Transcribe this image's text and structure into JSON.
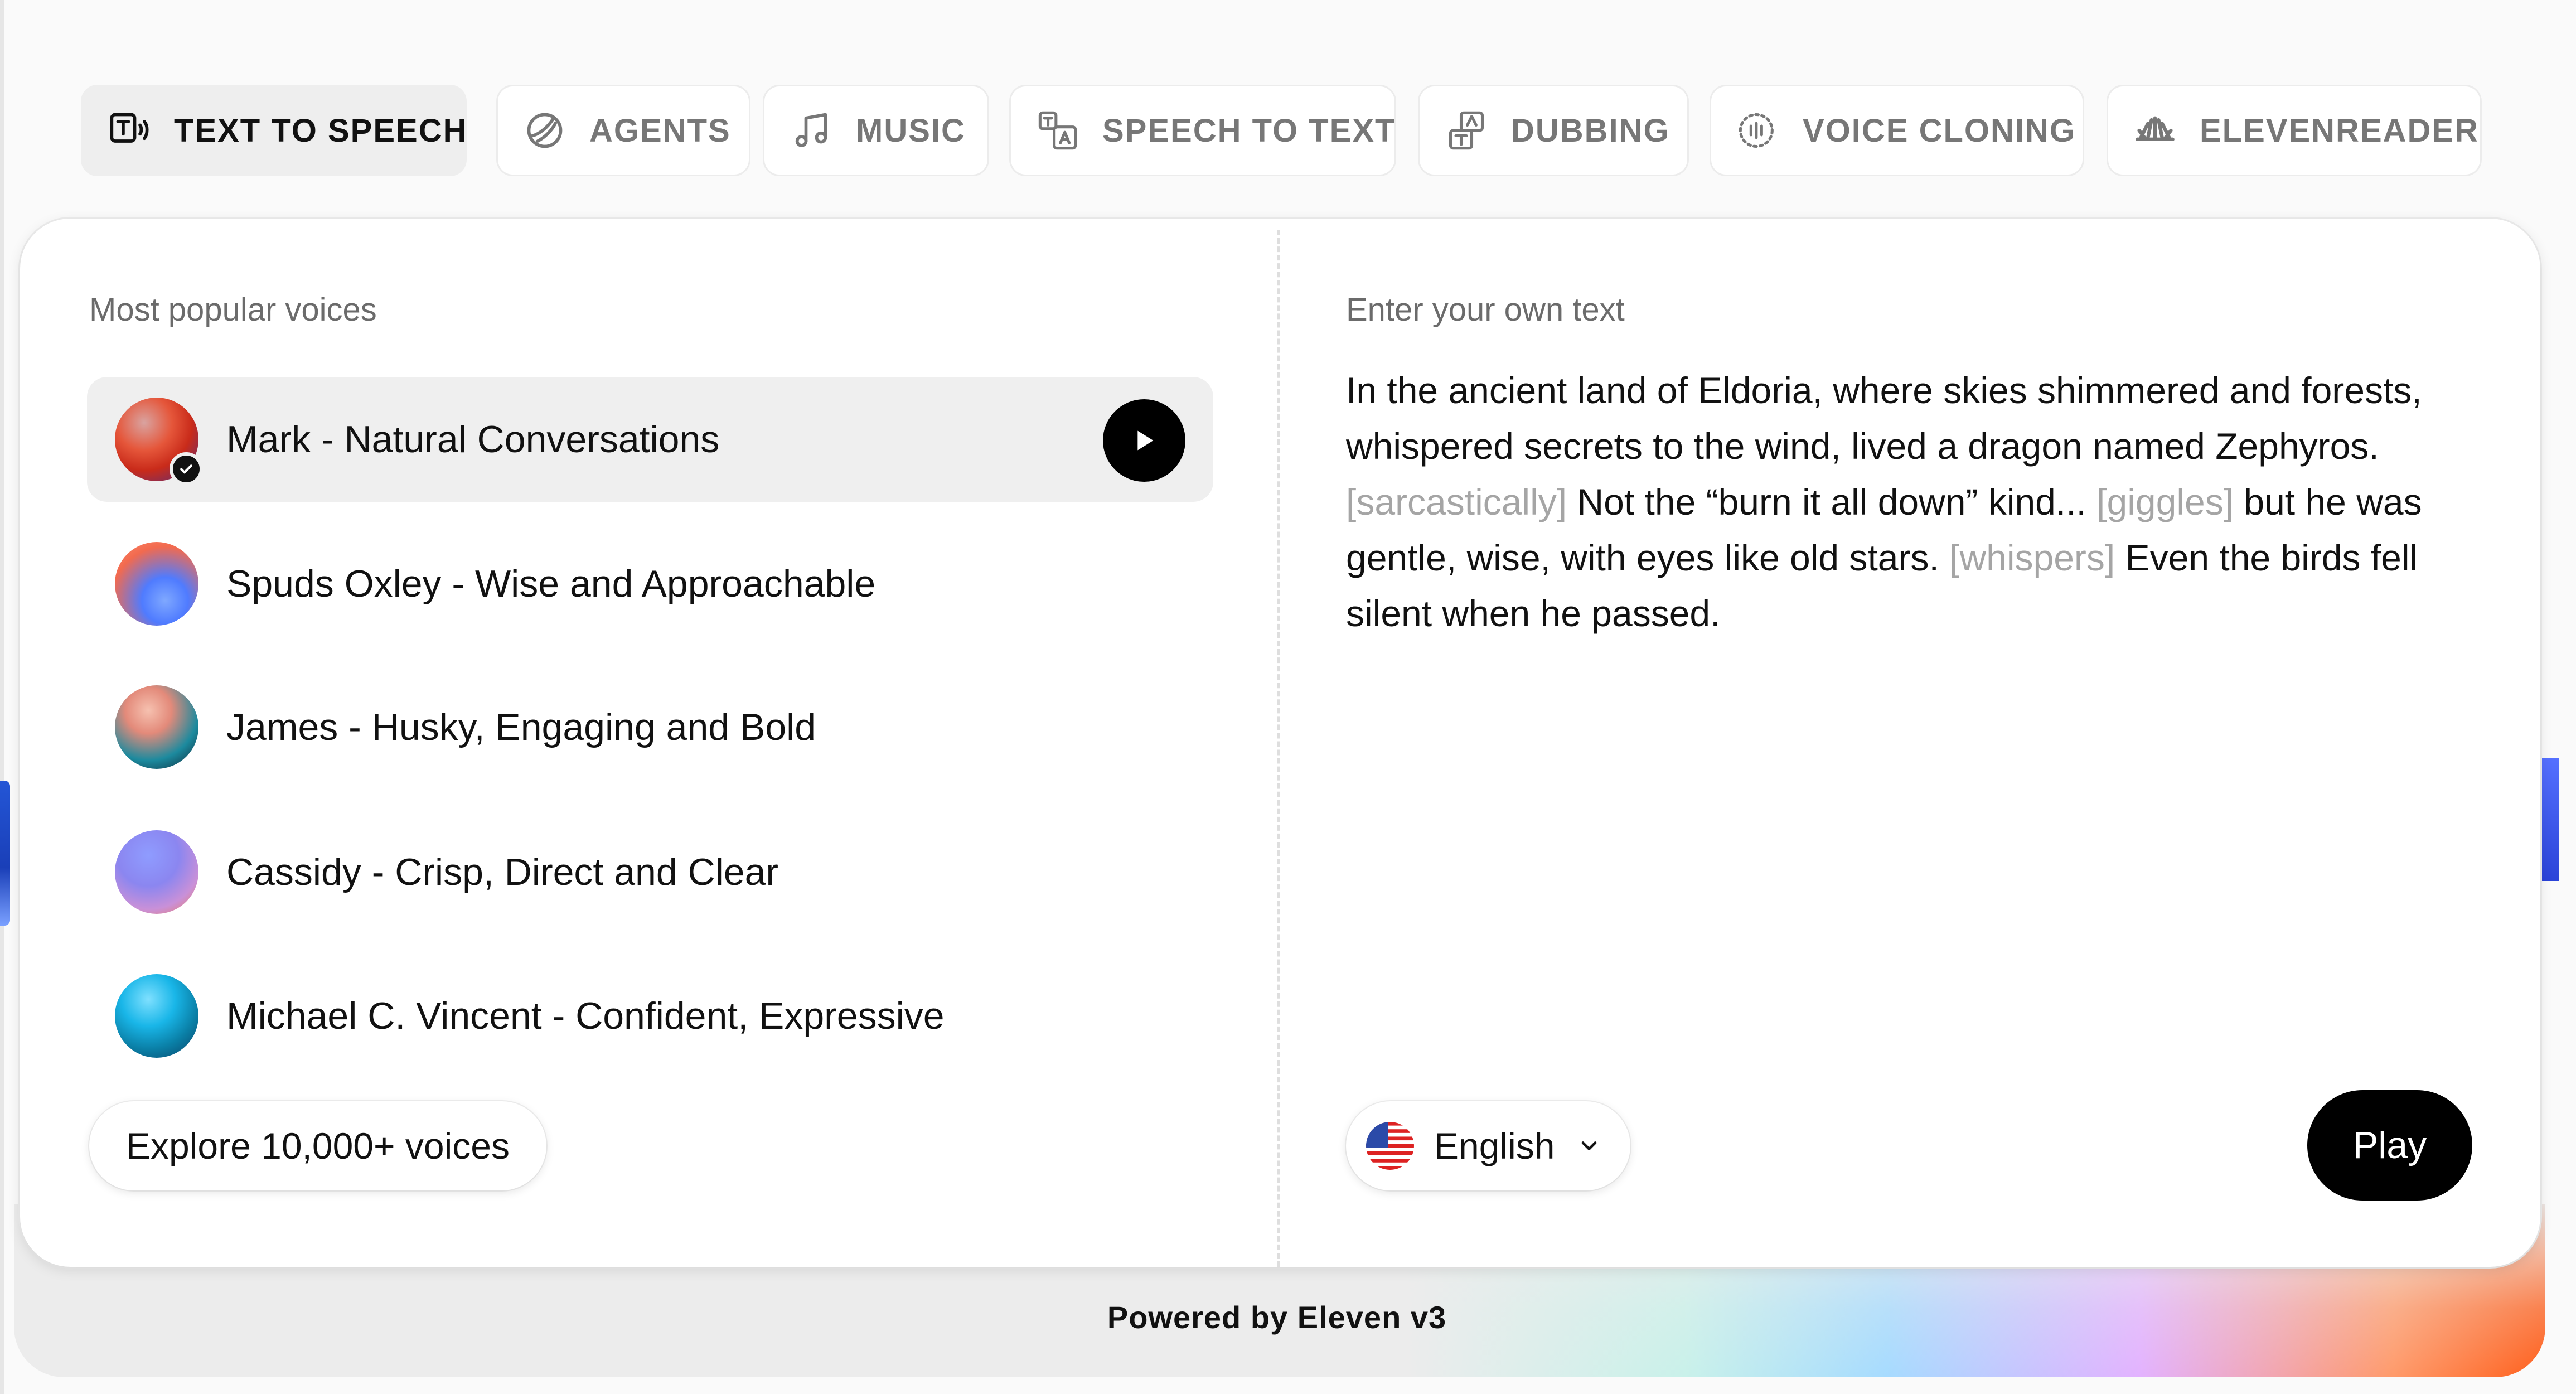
{
  "tabs": [
    {
      "label": "TEXT TO SPEECH",
      "icon": "text-to-speech-icon",
      "active": true
    },
    {
      "label": "AGENTS",
      "icon": "agents-icon"
    },
    {
      "label": "MUSIC",
      "icon": "music-note-icon"
    },
    {
      "label": "SPEECH TO TEXT",
      "icon": "speech-to-text-icon"
    },
    {
      "label": "DUBBING",
      "icon": "dubbing-icon"
    },
    {
      "label": "VOICE CLONING",
      "icon": "voice-cloning-icon"
    },
    {
      "label": "ELEVENREADER",
      "icon": "elevenreader-icon"
    }
  ],
  "voices_panel": {
    "heading": "Most popular voices",
    "voices": [
      {
        "label": "Mark - Natural Conversations",
        "selected": true
      },
      {
        "label": "Spuds Oxley - Wise and Approachable"
      },
      {
        "label": "James - Husky, Engaging and Bold"
      },
      {
        "label": "Cassidy - Crisp, Direct and Clear"
      },
      {
        "label": "Michael C. Vincent - Confident, Expressive"
      }
    ],
    "explore_label": "Explore 10,000+ voices"
  },
  "text_panel": {
    "heading": "Enter your own text",
    "story": [
      {
        "text": "In the ancient land of Eldoria, where skies shimmered and forests, whispered secrets to the wind, lived a dragon named Zephyros. "
      },
      {
        "text": "[sarcastically]",
        "tag": true
      },
      {
        "text": " Not the “burn it all down” kind... "
      },
      {
        "text": "[giggles]",
        "tag": true
      },
      {
        "text": " but he was gentle, wise, with eyes like old stars. "
      },
      {
        "text": "[whispers]",
        "tag": true
      },
      {
        "text": " Even the birds fell silent when he passed."
      }
    ],
    "language": "English",
    "play_label": "Play"
  },
  "footer": {
    "text": "Powered by Eleven v3"
  },
  "colors": {
    "accent": "#000000",
    "tag_text": "#a5a5a5",
    "active_tab_bg": "#eeeeee"
  }
}
